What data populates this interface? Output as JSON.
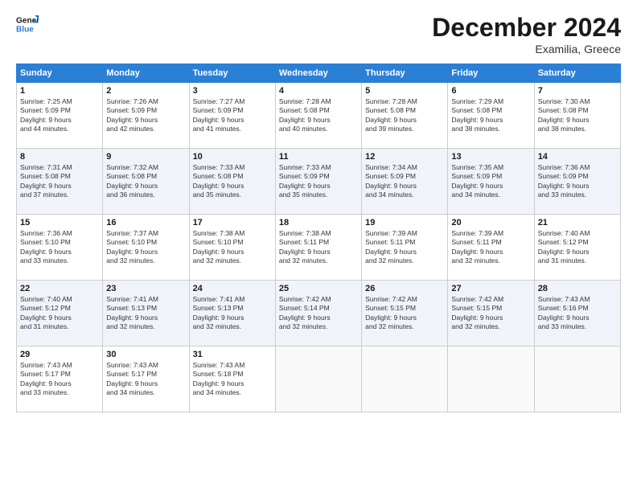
{
  "logo": {
    "line1": "General",
    "line2": "Blue"
  },
  "title": "December 2024",
  "subtitle": "Examilia, Greece",
  "headers": [
    "Sunday",
    "Monday",
    "Tuesday",
    "Wednesday",
    "Thursday",
    "Friday",
    "Saturday"
  ],
  "weeks": [
    [
      {
        "day": "1",
        "info": "Sunrise: 7:25 AM\nSunset: 5:09 PM\nDaylight: 9 hours\nand 44 minutes."
      },
      {
        "day": "2",
        "info": "Sunrise: 7:26 AM\nSunset: 5:09 PM\nDaylight: 9 hours\nand 42 minutes."
      },
      {
        "day": "3",
        "info": "Sunrise: 7:27 AM\nSunset: 5:09 PM\nDaylight: 9 hours\nand 41 minutes."
      },
      {
        "day": "4",
        "info": "Sunrise: 7:28 AM\nSunset: 5:08 PM\nDaylight: 9 hours\nand 40 minutes."
      },
      {
        "day": "5",
        "info": "Sunrise: 7:28 AM\nSunset: 5:08 PM\nDaylight: 9 hours\nand 39 minutes."
      },
      {
        "day": "6",
        "info": "Sunrise: 7:29 AM\nSunset: 5:08 PM\nDaylight: 9 hours\nand 38 minutes."
      },
      {
        "day": "7",
        "info": "Sunrise: 7:30 AM\nSunset: 5:08 PM\nDaylight: 9 hours\nand 38 minutes."
      }
    ],
    [
      {
        "day": "8",
        "info": "Sunrise: 7:31 AM\nSunset: 5:08 PM\nDaylight: 9 hours\nand 37 minutes."
      },
      {
        "day": "9",
        "info": "Sunrise: 7:32 AM\nSunset: 5:08 PM\nDaylight: 9 hours\nand 36 minutes."
      },
      {
        "day": "10",
        "info": "Sunrise: 7:33 AM\nSunset: 5:08 PM\nDaylight: 9 hours\nand 35 minutes."
      },
      {
        "day": "11",
        "info": "Sunrise: 7:33 AM\nSunset: 5:09 PM\nDaylight: 9 hours\nand 35 minutes."
      },
      {
        "day": "12",
        "info": "Sunrise: 7:34 AM\nSunset: 5:09 PM\nDaylight: 9 hours\nand 34 minutes."
      },
      {
        "day": "13",
        "info": "Sunrise: 7:35 AM\nSunset: 5:09 PM\nDaylight: 9 hours\nand 34 minutes."
      },
      {
        "day": "14",
        "info": "Sunrise: 7:36 AM\nSunset: 5:09 PM\nDaylight: 9 hours\nand 33 minutes."
      }
    ],
    [
      {
        "day": "15",
        "info": "Sunrise: 7:36 AM\nSunset: 5:10 PM\nDaylight: 9 hours\nand 33 minutes."
      },
      {
        "day": "16",
        "info": "Sunrise: 7:37 AM\nSunset: 5:10 PM\nDaylight: 9 hours\nand 32 minutes."
      },
      {
        "day": "17",
        "info": "Sunrise: 7:38 AM\nSunset: 5:10 PM\nDaylight: 9 hours\nand 32 minutes."
      },
      {
        "day": "18",
        "info": "Sunrise: 7:38 AM\nSunset: 5:11 PM\nDaylight: 9 hours\nand 32 minutes."
      },
      {
        "day": "19",
        "info": "Sunrise: 7:39 AM\nSunset: 5:11 PM\nDaylight: 9 hours\nand 32 minutes."
      },
      {
        "day": "20",
        "info": "Sunrise: 7:39 AM\nSunset: 5:11 PM\nDaylight: 9 hours\nand 32 minutes."
      },
      {
        "day": "21",
        "info": "Sunrise: 7:40 AM\nSunset: 5:12 PM\nDaylight: 9 hours\nand 31 minutes."
      }
    ],
    [
      {
        "day": "22",
        "info": "Sunrise: 7:40 AM\nSunset: 5:12 PM\nDaylight: 9 hours\nand 31 minutes."
      },
      {
        "day": "23",
        "info": "Sunrise: 7:41 AM\nSunset: 5:13 PM\nDaylight: 9 hours\nand 32 minutes."
      },
      {
        "day": "24",
        "info": "Sunrise: 7:41 AM\nSunset: 5:13 PM\nDaylight: 9 hours\nand 32 minutes."
      },
      {
        "day": "25",
        "info": "Sunrise: 7:42 AM\nSunset: 5:14 PM\nDaylight: 9 hours\nand 32 minutes."
      },
      {
        "day": "26",
        "info": "Sunrise: 7:42 AM\nSunset: 5:15 PM\nDaylight: 9 hours\nand 32 minutes."
      },
      {
        "day": "27",
        "info": "Sunrise: 7:42 AM\nSunset: 5:15 PM\nDaylight: 9 hours\nand 32 minutes."
      },
      {
        "day": "28",
        "info": "Sunrise: 7:43 AM\nSunset: 5:16 PM\nDaylight: 9 hours\nand 33 minutes."
      }
    ],
    [
      {
        "day": "29",
        "info": "Sunrise: 7:43 AM\nSunset: 5:17 PM\nDaylight: 9 hours\nand 33 minutes."
      },
      {
        "day": "30",
        "info": "Sunrise: 7:43 AM\nSunset: 5:17 PM\nDaylight: 9 hours\nand 34 minutes."
      },
      {
        "day": "31",
        "info": "Sunrise: 7:43 AM\nSunset: 5:18 PM\nDaylight: 9 hours\nand 34 minutes."
      },
      {
        "day": "",
        "info": ""
      },
      {
        "day": "",
        "info": ""
      },
      {
        "day": "",
        "info": ""
      },
      {
        "day": "",
        "info": ""
      }
    ]
  ]
}
